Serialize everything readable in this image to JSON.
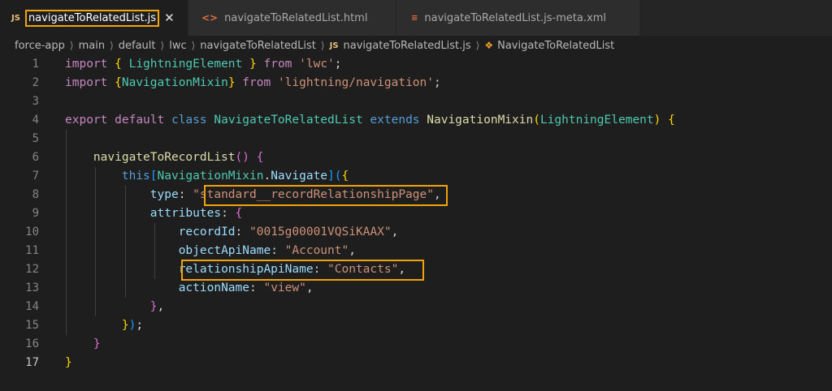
{
  "tabs": [
    {
      "icon": "JS",
      "title": "navigateToRelatedList.js",
      "close": "✕",
      "active": true
    },
    {
      "icon": "<>",
      "title": "navigateToRelatedList.html"
    },
    {
      "icon": "≡",
      "title": "navigateToRelatedList.js-meta.xml"
    }
  ],
  "breadcrumbs": {
    "items": [
      "force-app",
      "main",
      "default",
      "lwc",
      "navigateToRelatedList"
    ],
    "file_icon": "JS",
    "file": "navigateToRelatedList.js",
    "symbol": "NavigateToRelatedList"
  },
  "line_numbers": [
    "1",
    "2",
    "3",
    "4",
    "5",
    "6",
    "7",
    "8",
    "9",
    "10",
    "11",
    "12",
    "13",
    "14",
    "15",
    "16",
    "17"
  ],
  "code": {
    "l1": {
      "kw": "import",
      "b1o": "{",
      "name": "LightningElement",
      "b1c": "}",
      "from": "from",
      "str": "'lwc'",
      "semi": ";"
    },
    "l2": {
      "kw": "import",
      "b1o": "{",
      "name": "NavigationMixin",
      "b1c": "}",
      "from": "from",
      "str": "'lightning/navigation'",
      "semi": ";"
    },
    "l4": {
      "export": "export",
      "default": "default",
      "class": "class",
      "name": "NavigateToRelatedList",
      "extends": "extends",
      "fn": "NavigationMixin",
      "po": "(",
      "arg": "LightningElement",
      "pc": ")",
      "brace": "{"
    },
    "l6": {
      "fn": "navigateToRecordList",
      "parens": "()",
      "brace": "{"
    },
    "l7": {
      "this": "this",
      "bo": "[",
      "obj": "NavigationMixin",
      "dot": ".",
      "prop": "Navigate",
      "bc": "]",
      "po": "(",
      "cb": "{"
    },
    "l8": {
      "key": "type",
      "colon": ": ",
      "q1": "\"",
      "val": "standard__recordRelationshipPage",
      "q2": "\"",
      "comma": ","
    },
    "l9": {
      "key": "attributes",
      "colon": ": ",
      "brace": "{"
    },
    "l10": {
      "key": "recordId",
      "colon": ": ",
      "val": "\"0015g00001VQSiKAAX\"",
      "comma": ","
    },
    "l11": {
      "key": "objectApiName",
      "colon": ": ",
      "val": "\"Account\"",
      "comma": ","
    },
    "l12": {
      "key": "relationshipApiName",
      "colon": ": ",
      "val": "\"Contacts\"",
      "comma": ","
    },
    "l13": {
      "key": "actionName",
      "colon": ": ",
      "val": "\"view\"",
      "comma": ","
    },
    "l14": {
      "brace": "}",
      "comma": ","
    },
    "l15": {
      "brace": "}",
      "paren": ")",
      "semi": ";"
    },
    "l16": {
      "brace": "}"
    },
    "l17": {
      "brace": "}"
    }
  }
}
